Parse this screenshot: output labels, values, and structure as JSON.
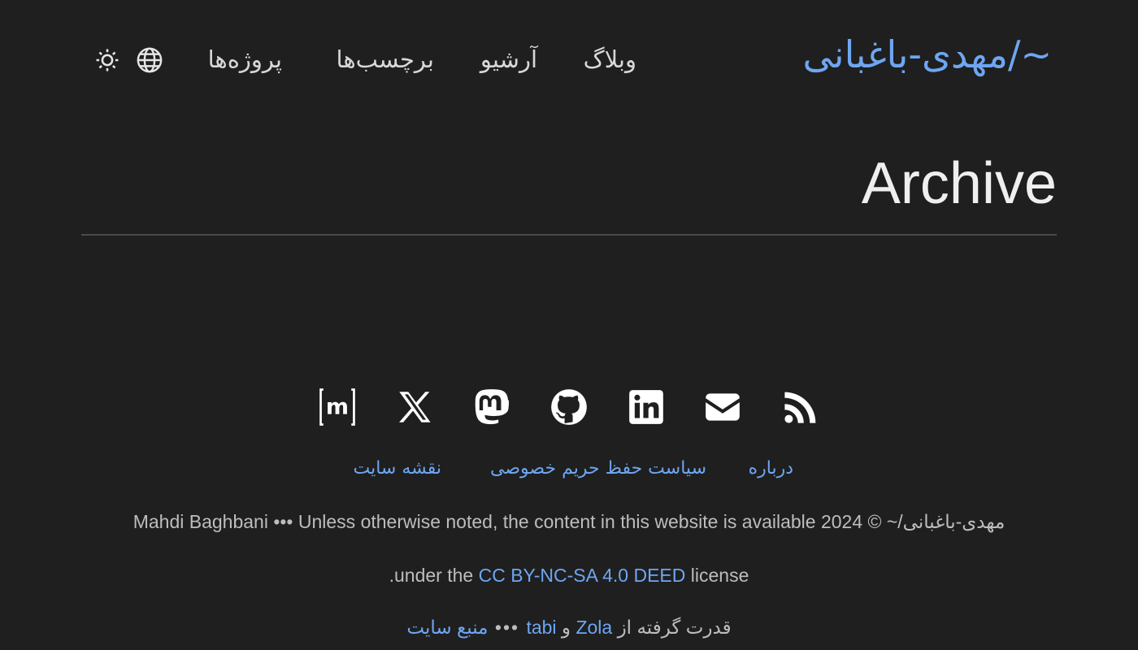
{
  "header": {
    "site_title": "~/مهدی-باغبانی",
    "nav": {
      "blog": "وبلاگ",
      "archive": "آرشیو",
      "tags": "برچسب‌ها",
      "projects": "پروژه‌ها"
    },
    "icons": [
      "globe-icon",
      "sun-icon"
    ]
  },
  "main": {
    "title": "Archive"
  },
  "social_icons": [
    "rss-icon",
    "mail-icon",
    "linkedin-icon",
    "github-icon",
    "mastodon-icon",
    "x-icon",
    "matrix-icon"
  ],
  "footer": {
    "links": {
      "about": "درباره",
      "privacy": "سیاست حفظ حریم خصوصی",
      "sitemap": "نقشه سایت"
    },
    "line1": "Mahdi Baghbani ••• Unless otherwise noted, the content in this website is available 2024 © ~/مهدی-باغبانی",
    "line2": {
      "prefix": ".under the ",
      "license_link": "CC BY-NC-SA 4.0 DEED",
      "suffix": " license"
    },
    "line3": {
      "powered": "قدرت گرفته از ",
      "zola": "Zola",
      "and": " و ",
      "tabi": "tabi",
      "dots": " ••• ",
      "source": "منبع سایت"
    }
  },
  "colors": {
    "background": "#1f1f1f",
    "accent": "#6ea6f2",
    "text": "#d6d6d6"
  }
}
